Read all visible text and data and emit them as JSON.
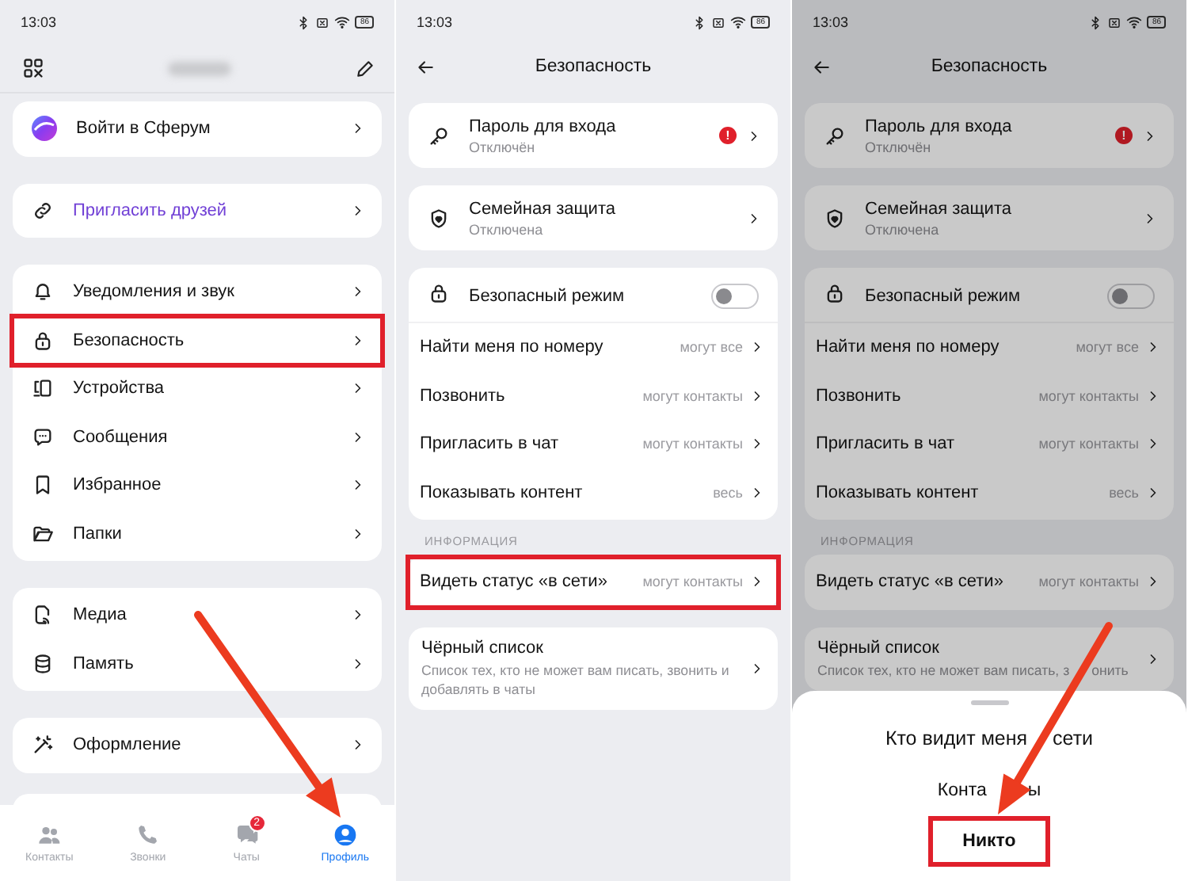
{
  "profile_screen": {
    "time": "13:03",
    "battery": "86",
    "groups": [
      {
        "rows": [
          {
            "label": "Войти в Сферум",
            "kind": "plain",
            "highlighted": false
          }
        ]
      },
      {
        "rows": [
          {
            "label": "Пригласить друзей",
            "kind": "accent",
            "highlighted": false
          }
        ]
      },
      {
        "rows": [
          {
            "label": "Уведомления и звук",
            "kind": "plain",
            "highlighted": false
          },
          {
            "label": "Безопасность",
            "kind": "plain",
            "highlighted": true
          },
          {
            "label": "Устройства",
            "kind": "plain",
            "highlighted": false
          },
          {
            "label": "Сообщения",
            "kind": "plain",
            "highlighted": false
          },
          {
            "label": "Избранное",
            "kind": "plain",
            "highlighted": false
          },
          {
            "label": "Папки",
            "kind": "plain",
            "highlighted": false
          }
        ]
      },
      {
        "rows": [
          {
            "label": "Медиа",
            "kind": "plain",
            "highlighted": false
          },
          {
            "label": "Память",
            "kind": "plain",
            "highlighted": false
          }
        ]
      },
      {
        "rows": [
          {
            "label": "Оформление",
            "kind": "plain",
            "highlighted": false
          }
        ]
      }
    ],
    "tabs": [
      {
        "label": "Контакты",
        "selected": false
      },
      {
        "label": "Звонки",
        "selected": false
      },
      {
        "label": "Чаты",
        "selected": false,
        "badge": "2"
      },
      {
        "label": "Профиль",
        "selected": true
      }
    ]
  },
  "security_screen": {
    "time": "13:03",
    "battery": "86",
    "title": "Безопасность",
    "items": [
      {
        "title": "Пароль для входа",
        "subtitle": "Отключён",
        "badge": "!"
      },
      {
        "title": "Семейная защита",
        "subtitle": "Отключена"
      }
    ],
    "safe_mode": {
      "label": "Безопасный режим",
      "on": false
    },
    "privacy_rows": [
      {
        "label": "Найти меня по номеру",
        "value": "могут все"
      },
      {
        "label": "Позвонить",
        "value": "могут контакты"
      },
      {
        "label": "Пригласить в чат",
        "value": "могут контакты"
      },
      {
        "label": "Показывать контент",
        "value": "весь"
      }
    ],
    "section_label": "ИНФОРМАЦИЯ",
    "online_status": {
      "label": "Видеть статус «в сети»",
      "value": "могут контакты",
      "highlighted": true
    },
    "blacklist": {
      "title": "Чёрный список",
      "subtitle": "Список тех, кто не может вам писать, звонить и добавлять в чаты"
    }
  },
  "security_sheet_screen": {
    "time": "13:03",
    "battery": "86",
    "title": "Безопасность",
    "items": [
      {
        "title": "Пароль для входа",
        "subtitle": "Отключён",
        "badge": "!"
      },
      {
        "title": "Семейная защита",
        "subtitle": "Отключена"
      }
    ],
    "safe_mode": {
      "label": "Безопасный режим",
      "on": false
    },
    "privacy_rows": [
      {
        "label": "Найти меня по номеру",
        "value": "могут все"
      },
      {
        "label": "Позвонить",
        "value": "могут контакты"
      },
      {
        "label": "Пригласить в чат",
        "value": "могут контакты"
      },
      {
        "label": "Показывать контент",
        "value": "весь"
      }
    ],
    "section_label": "ИНФОРМАЦИЯ",
    "online_status": {
      "label": "Видеть статус «в сети»",
      "value": "могут контакты",
      "highlighted": false
    },
    "blacklist": {
      "title": "Чёрный список",
      "subtitle_parts": [
        "Список тех, кто не может вам писать, з",
        "онить"
      ]
    },
    "sheet": {
      "title_parts": [
        "Кто видит меня",
        "сети"
      ],
      "options": [
        {
          "label_parts": [
            "Конта",
            "ы"
          ],
          "highlighted": false
        },
        {
          "label_parts": [
            "Никто"
          ],
          "highlighted": true
        }
      ]
    }
  }
}
